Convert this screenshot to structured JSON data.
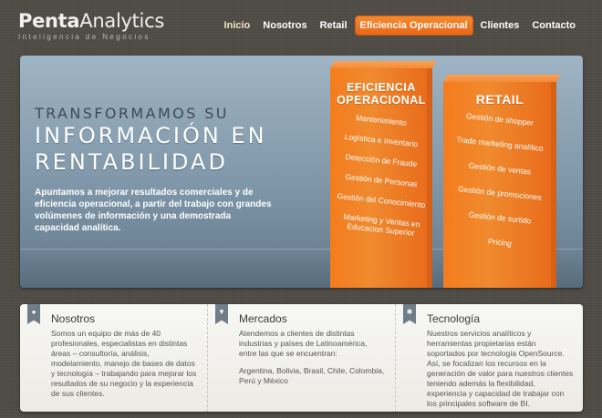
{
  "header": {
    "logo_bold": "Penta",
    "logo_light": "Analytics",
    "tagline": "Inteligencia de Negocios"
  },
  "nav": {
    "items": [
      "Inicio",
      "Nosotros",
      "Retail",
      "Eficiencia Operacional",
      "Clientes",
      "Contacto"
    ],
    "active": "Eficiencia Operacional"
  },
  "hero": {
    "line1": "TRANSFORMAMOS SU",
    "line2": "INFORMACIÓN EN",
    "line3": "RENTABILIDAD",
    "description": "Apuntamos a mejorar resultados comerciales y de eficiencia operacional, a partir del trabajo con grandes volúmenes de información y una demostrada capacidad analítica.",
    "eficiencia": {
      "title_line1": "EFICIENCIA",
      "title_line2": "OPERACIONAL",
      "items": [
        "Mantenimiento",
        "Logística e Inventario",
        "Detección de Fraude",
        "Gestión de Personas",
        "Gestión del Conocimiento",
        "Marketing y Ventas en Educacion Superior"
      ]
    },
    "retail": {
      "title": "RETAIL",
      "items": [
        "Gestión de shopper",
        "Trade marketing analítico",
        "Gestión de ventas",
        "Gestión de promociones",
        "Gestión de surtido",
        "Pricing"
      ]
    }
  },
  "panels": {
    "nosotros": {
      "title": "Nosotros",
      "text": "Somos un equipo de más de 40 profesionales, especialistas en distintas áreas – consultoría, análisis, modelamiento, manejo de bases de datos y tecnología – trabajando para mejorar los resultados de su negocio y la experiencia de sus clientes."
    },
    "mercados": {
      "title": "Mercados",
      "text": "Atendemos a clientes de distintas industrias y países de Latinoamérica, entre las que se encuentran:",
      "countries": "Argentina, Bolivia, Brasil, Chile, Colombia, Perú y México"
    },
    "tecnologia": {
      "title": "Tecnología",
      "text": "Nuestros servicios analíticos y herramientas propietarias están soportados por tecnología OpenSource. Así, se focalizan los recursos en la generación de valor para nuestros clientes teniendo además la flexibilidad, experiencia y capacidad de trabajar con los principales software de BI."
    }
  },
  "colors": {
    "accent": "#f07a22",
    "hero_bg": "#8aa0b2",
    "page_bg": "#4e4b45"
  }
}
